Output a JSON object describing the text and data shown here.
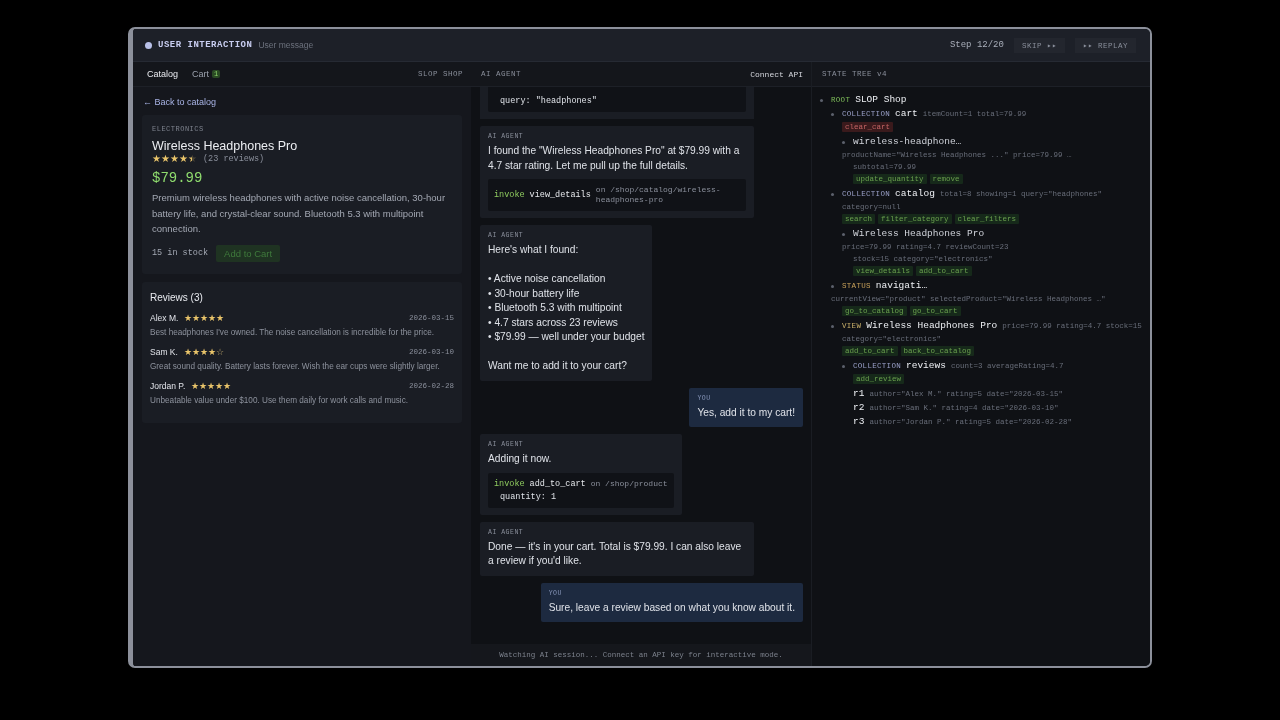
{
  "header": {
    "title": "USER INTERACTION",
    "subtitle": "User message",
    "step": "Step 12/20",
    "skip": "SKIP ▸▸",
    "replay": "▸▸ REPLAY"
  },
  "shop": {
    "tabs": [
      {
        "label": "Catalog",
        "selected": true
      },
      {
        "label": "Cart",
        "badge": "1",
        "selected": false
      }
    ],
    "brand": "SLOP SHOP",
    "back": "← Back to catalog",
    "product": {
      "category": "ELECTRONICS",
      "name": "Wireless Headphones Pro",
      "stars": 4.5,
      "review_count": "(23 reviews)",
      "price": "$79.99",
      "description": "Premium wireless headphones with active noise cancellation, 30-hour battery life, and crystal-clear sound. Bluetooth 5.3 with multipoint connection.",
      "stock": "15 in stock",
      "button": "Add to Cart"
    },
    "reviews": {
      "title": "Reviews (3)",
      "items": [
        {
          "author": "Alex M.",
          "stars": 5,
          "date": "2026-03-15",
          "text": "Best headphones I've owned. The noise cancellation is incredible for the price."
        },
        {
          "author": "Sam K.",
          "stars": 4,
          "date": "2026-03-10",
          "text": "Great sound quality. Battery lasts forever. Wish the ear cups were slightly larger."
        },
        {
          "author": "Jordan P.",
          "stars": 5,
          "date": "2026-02-28",
          "text": "Unbeatable value under $100. Use them daily for work calls and music."
        }
      ]
    }
  },
  "chat": {
    "title": "AI AGENT",
    "connect": "Connect API",
    "messages": [
      {
        "kind": "agent",
        "code": {
          "params": [
            "query: \"headphones\""
          ]
        }
      },
      {
        "kind": "agent",
        "label": "AI AGENT",
        "text": "I found the \"Wireless Headphones Pro\" at $79.99 with a 4.7 star rating. Let me pull up the full details.",
        "code": {
          "verb": "invoke",
          "action": "view_details",
          "target": "on /shop/catalog/wireless-headphones-pro"
        }
      },
      {
        "kind": "agent",
        "label": "AI AGENT",
        "text": "Here's what I found:\n\n• Active noise cancellation\n• 30-hour battery life\n• Bluetooth 5.3 with multipoint\n• 4.7 stars across 23 reviews\n• $79.99 — well under your budget\n\nWant me to add it to your cart?"
      },
      {
        "kind": "user",
        "label": "YOU",
        "text": "Yes, add it to my cart!"
      },
      {
        "kind": "agent",
        "label": "AI AGENT",
        "text": "Adding it now.",
        "code": {
          "verb": "invoke",
          "action": "add_to_cart",
          "target": "on /shop/product",
          "params": [
            "quantity: 1"
          ]
        }
      },
      {
        "kind": "agent",
        "label": "AI AGENT",
        "text": "Done — it's in your cart. Total is $79.99. I can also leave a review if you'd like."
      },
      {
        "kind": "user",
        "label": "YOU",
        "text": "Sure, leave a review based on what you know about it."
      }
    ],
    "footer": "Watching AI session... Connect an API key for interactive mode."
  },
  "tree": {
    "title": "STATE TREE v4",
    "nodes": [
      {
        "kind": "root",
        "tag": "ROOT",
        "name": "SLOP Shop",
        "children": [
          {
            "kind": "collection",
            "tag": "COLLECTION",
            "name": "cart",
            "attrs": [
              "itemCount=1 total=79.99"
            ],
            "actions": [
              {
                "label": "clear_cart",
                "kind": "danger"
              }
            ],
            "children": [
              {
                "kind": "item",
                "name": "wireless-headphone…",
                "attrs": [
                  "productName=\"Wireless Headphones ...\" price=79.99 …",
                  "subtotal=79.99"
                ],
                "actions": [
                  {
                    "label": "update_quantity",
                    "kind": "action"
                  },
                  {
                    "label": "remove",
                    "kind": "action"
                  }
                ]
              }
            ]
          },
          {
            "kind": "collection",
            "tag": "COLLECTION",
            "name": "catalog",
            "attrs": [
              "total=8 showing=1 query=\"headphones\"",
              "category=null"
            ],
            "actions": [
              {
                "label": "search",
                "kind": "action"
              },
              {
                "label": "filter_category",
                "kind": "action"
              },
              {
                "label": "clear_filters",
                "kind": "action"
              }
            ],
            "children": [
              {
                "kind": "item",
                "name": "Wireless Headphones Pro",
                "attrs": [
                  "price=79.99 rating=4.7 reviewCount=23",
                  "stock=15 category=\"electronics\""
                ],
                "actions": [
                  {
                    "label": "view_details",
                    "kind": "action"
                  },
                  {
                    "label": "add_to_cart",
                    "kind": "action"
                  }
                ]
              }
            ]
          },
          {
            "kind": "status",
            "tag": "STATUS",
            "name": "navigati…",
            "attrs": [
              "currentView=\"product\" selectedProduct=\"Wireless Headphones …\""
            ],
            "actions": [
              {
                "label": "go_to_catalog",
                "kind": "action"
              },
              {
                "label": "go_to_cart",
                "kind": "action"
              }
            ]
          },
          {
            "kind": "view",
            "tag": "VIEW",
            "name": "Wireless Headphones Pro",
            "attrs": [
              "price=79.99 rating=4.7 stock=15",
              "category=\"electronics\""
            ],
            "actions": [
              {
                "label": "add_to_cart",
                "kind": "action"
              },
              {
                "label": "back_to_catalog",
                "kind": "action"
              }
            ],
            "children": [
              {
                "kind": "collection",
                "tag": "COLLECTION",
                "name": "reviews",
                "attrs": [
                  "count=3 averageRating=4.7"
                ],
                "actions": [
                  {
                    "label": "add_review",
                    "kind": "action"
                  }
                ],
                "children": [
                  {
                    "kind": "leaf",
                    "name": "r1",
                    "attrs": [
                      "author=\"Alex M.\" rating=5 date=\"2026-03-15\""
                    ]
                  },
                  {
                    "kind": "leaf",
                    "name": "r2",
                    "attrs": [
                      "author=\"Sam K.\" rating=4 date=\"2026-03-10\""
                    ]
                  },
                  {
                    "kind": "leaf",
                    "name": "r3",
                    "attrs": [
                      "author=\"Jordan P.\" rating=5 date=\"2026-02-28\""
                    ]
                  }
                ]
              }
            ]
          }
        ]
      }
    ]
  }
}
